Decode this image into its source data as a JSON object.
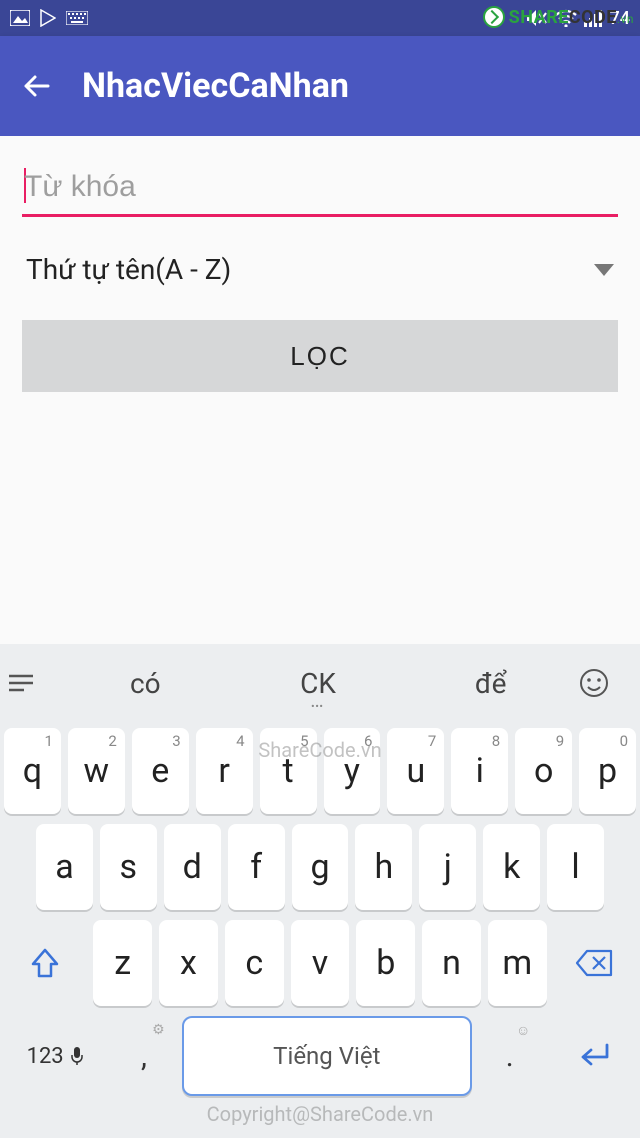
{
  "status": {
    "battery": "74"
  },
  "watermark": {
    "brand_share": "SHARE",
    "brand_code": "CODE",
    "tld": ".vn",
    "center": "ShareCode.vn",
    "bottom": "Copyright@ShareCode.vn"
  },
  "appbar": {
    "title": "NhacViecCaNhan"
  },
  "form": {
    "search_placeholder": "Từ khóa",
    "sort_selected": "Thứ tự tên(A - Z)",
    "filter_label": "LỌC"
  },
  "keyboard": {
    "suggestions": [
      "có",
      "CK",
      "để"
    ],
    "row1": [
      {
        "k": "q",
        "n": "1"
      },
      {
        "k": "w",
        "n": "2"
      },
      {
        "k": "e",
        "n": "3"
      },
      {
        "k": "r",
        "n": "4"
      },
      {
        "k": "t",
        "n": "5"
      },
      {
        "k": "y",
        "n": "6"
      },
      {
        "k": "u",
        "n": "7"
      },
      {
        "k": "i",
        "n": "8"
      },
      {
        "k": "o",
        "n": "9"
      },
      {
        "k": "p",
        "n": "0"
      }
    ],
    "row2": [
      "a",
      "s",
      "d",
      "f",
      "g",
      "h",
      "j",
      "k",
      "l"
    ],
    "row3": [
      "z",
      "x",
      "c",
      "v",
      "b",
      "n",
      "m"
    ],
    "num_label": "123",
    "comma": ",",
    "space_label": "Tiếng Việt",
    "dot": "."
  }
}
